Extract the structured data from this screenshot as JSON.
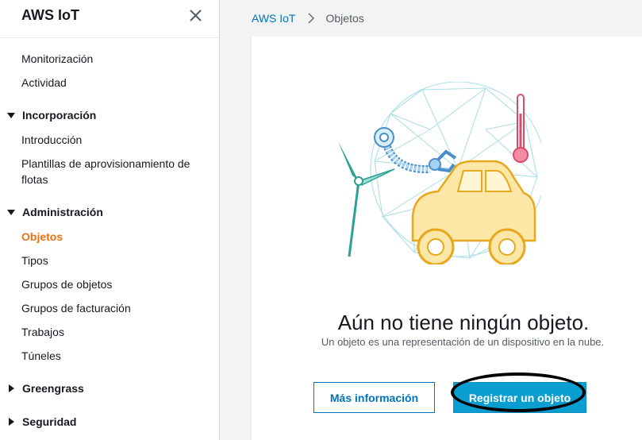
{
  "sidebar": {
    "title": "AWS IoT",
    "links_top": [
      {
        "label": "Monitorización"
      },
      {
        "label": "Actividad"
      }
    ],
    "section_incorporacion": {
      "label": "Incorporación",
      "items": [
        {
          "label": "Introducción"
        },
        {
          "label": "Plantillas de aprovisionamiento de flotas"
        }
      ]
    },
    "section_administracion": {
      "label": "Administración",
      "items": [
        {
          "label": "Objetos"
        },
        {
          "label": "Tipos"
        },
        {
          "label": "Grupos de objetos"
        },
        {
          "label": "Grupos de facturación"
        },
        {
          "label": "Trabajos"
        },
        {
          "label": "Túneles"
        }
      ]
    },
    "section_greengrass": {
      "label": "Greengrass"
    },
    "section_seguridad": {
      "label": "Seguridad"
    }
  },
  "breadcrumb": {
    "root": "AWS IoT",
    "current": "Objetos"
  },
  "empty_state": {
    "title": "Aún no tiene ningún objeto.",
    "description": "Un objeto es una representación de un dispositivo en la nube.",
    "learn_more_label": "Más información",
    "register_label": "Registrar un objeto"
  },
  "colors": {
    "accent_active": "#ec7211",
    "link": "#0073bb",
    "primary_button": "#0a9dd0"
  },
  "icons": [
    "close-icon",
    "caret-down-icon",
    "caret-right-icon",
    "chevron-right-icon"
  ]
}
